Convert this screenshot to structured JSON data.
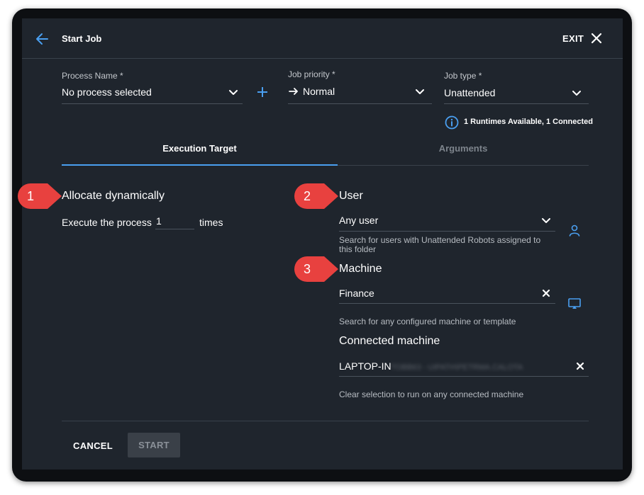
{
  "header": {
    "title": "Start Job",
    "exit_label": "EXIT"
  },
  "form": {
    "process_name": {
      "label": "Process Name *",
      "value": "No process selected"
    },
    "job_priority": {
      "label": "Job priority *",
      "value": "Normal"
    },
    "job_type": {
      "label": "Job type *",
      "value": "Unattended"
    },
    "runtimes_info": "1 Runtimes Available, 1 Connected"
  },
  "tabs": [
    {
      "label": "Execution Target",
      "active": true
    },
    {
      "label": "Arguments",
      "active": false
    }
  ],
  "left": {
    "title": "Allocate dynamically",
    "execute_prefix": "Execute the process",
    "execute_count": "1",
    "execute_suffix": "times"
  },
  "right": {
    "user": {
      "title": "User",
      "value": "Any user",
      "helper": "Search for users with Unattended Robots assigned to this folder"
    },
    "machine": {
      "title": "Machine",
      "value": "Finance",
      "helper": "Search for any configured machine or template"
    },
    "connected_machine": {
      "title": "Connected machine",
      "value_prefix": "LAPTOP-IN",
      "value_obscured": "TOBB63 - UIPATH\\PETRMA.CALOTA",
      "helper": "Clear selection to run on any connected machine"
    }
  },
  "callouts": [
    "1",
    "2",
    "3"
  ],
  "footer": {
    "cancel_label": "CANCEL",
    "start_label": "START"
  },
  "colors": {
    "dialog_bg": "#1f252d",
    "accent": "#4a9ff0",
    "callout_red": "#e8413f",
    "disabled_button": "#3a4048"
  }
}
